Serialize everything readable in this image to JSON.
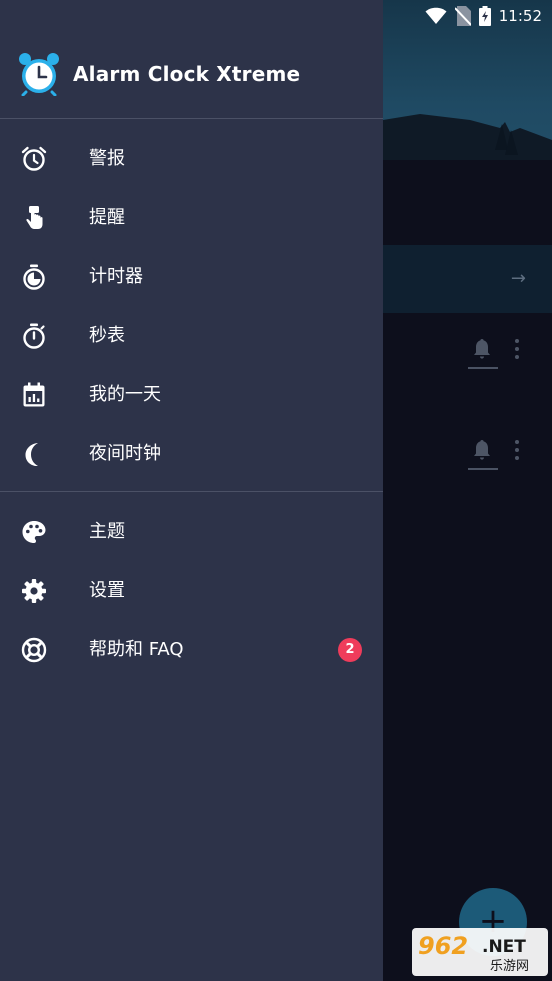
{
  "status_bar": {
    "time": "11:52"
  },
  "drawer": {
    "app_title": "Alarm Clock Xtreme",
    "items": [
      {
        "label": "警报",
        "icon": "alarm-icon"
      },
      {
        "label": "提醒",
        "icon": "reminder-hand-icon"
      },
      {
        "label": "计时器",
        "icon": "timer-icon"
      },
      {
        "label": "秒表",
        "icon": "stopwatch-icon"
      },
      {
        "label": "我的一天",
        "icon": "calendar-icon"
      },
      {
        "label": "夜间时钟",
        "icon": "moon-icon"
      },
      {
        "label": "主题",
        "icon": "palette-icon"
      },
      {
        "label": "设置",
        "icon": "gear-icon"
      },
      {
        "label": "帮助和 FAQ",
        "icon": "lifebuoy-icon",
        "badge": "2"
      }
    ]
  },
  "background": {
    "fab_label": "+",
    "banner_arrow": "→"
  },
  "watermark": {
    "brand": "962",
    "suffix": ".NET",
    "subtitle": "乐游网"
  },
  "colors": {
    "drawer_bg": "#2d3349",
    "badge": "#ef3c5b",
    "accent_blue": "#2bb0ea"
  }
}
